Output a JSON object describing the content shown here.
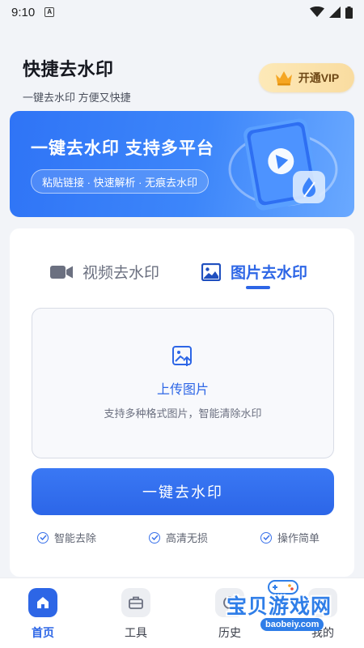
{
  "status_bar": {
    "time": "9:10",
    "notification": "A"
  },
  "header": {
    "title": "快捷去水印",
    "subtitle": "一键去水印  方便又快捷"
  },
  "vip": {
    "label": "开通VIP"
  },
  "banner": {
    "title": "一键去水印 支持多平台",
    "pill": "粘贴链接 · 快速解析 · 无痕去水印"
  },
  "tabs": [
    {
      "label": "视频去水印",
      "icon": "video-camera-icon",
      "active": false
    },
    {
      "label": "图片去水印",
      "icon": "image-icon",
      "active": true
    }
  ],
  "upload": {
    "title": "上传图片",
    "hint": "支持多种格式图片，智能清除水印"
  },
  "action": {
    "label": "一键去水印"
  },
  "features": [
    "智能去除",
    "高清无损",
    "操作简单"
  ],
  "tabbar": [
    {
      "label": "首页",
      "icon": "home-icon",
      "active": true
    },
    {
      "label": "工具",
      "icon": "toolbox-icon",
      "active": false
    },
    {
      "label": "历史",
      "icon": "history-icon",
      "active": false
    },
    {
      "label": "我的",
      "icon": "user-icon",
      "active": false
    }
  ],
  "watermark": {
    "text": "宝贝游戏网",
    "url": "baobeiy.com"
  },
  "colors": {
    "primary": "#2d66e6",
    "background": "#f2f4f8",
    "vip": "#f9dca0"
  }
}
